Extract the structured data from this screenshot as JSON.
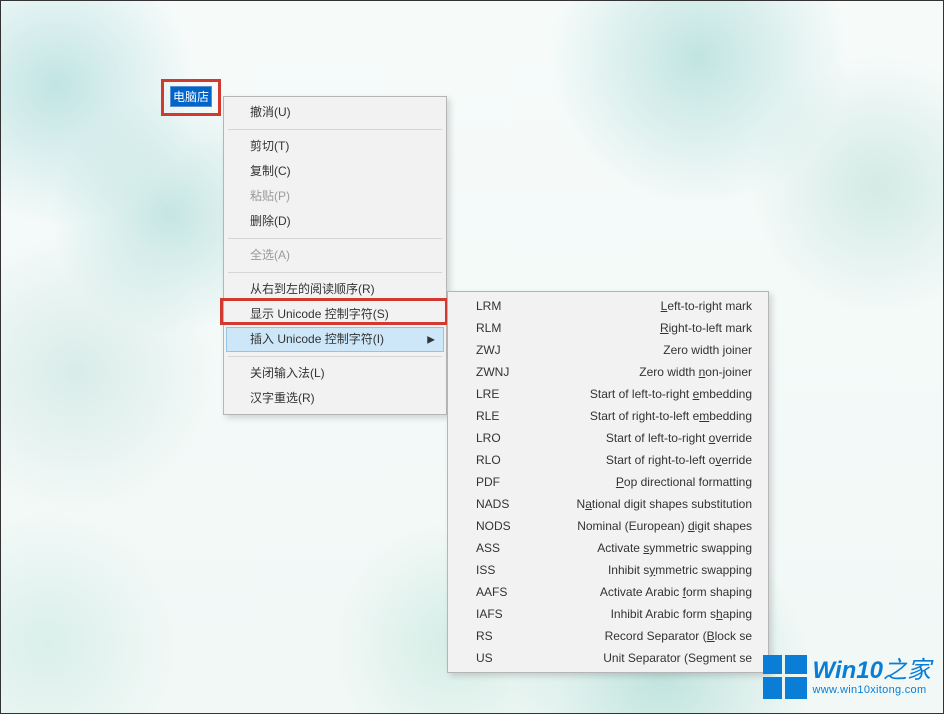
{
  "rename": {
    "selected_text": "电脑店"
  },
  "context_menu": {
    "undo": "撤消(U)",
    "cut": "剪切(T)",
    "copy": "复制(C)",
    "paste": "粘贴(P)",
    "delete": "删除(D)",
    "select_all": "全选(A)",
    "rtl_reading": "从右到左的阅读顺序(R)",
    "show_unicode": "显示 Unicode 控制字符(S)",
    "insert_unicode": "插入 Unicode 控制字符(I)",
    "close_ime": "关闭输入法(L)",
    "hanzi_reselect": "汉字重选(R)"
  },
  "submenu": [
    {
      "code": "LRM",
      "desc_pre": "",
      "hot": "L",
      "desc_post": "eft-to-right mark"
    },
    {
      "code": "RLM",
      "desc_pre": "",
      "hot": "R",
      "desc_post": "ight-to-left mark"
    },
    {
      "code": "ZWJ",
      "desc_pre": "Zero width ",
      "hot": "j",
      "desc_post": "oiner"
    },
    {
      "code": "ZWNJ",
      "desc_pre": "Zero width ",
      "hot": "n",
      "desc_post": "on-joiner"
    },
    {
      "code": "LRE",
      "desc_pre": "Start of left-to-right ",
      "hot": "e",
      "desc_post": "mbedding"
    },
    {
      "code": "RLE",
      "desc_pre": "Start of right-to-left e",
      "hot": "m",
      "desc_post": "bedding"
    },
    {
      "code": "LRO",
      "desc_pre": "Start of left-to-right ",
      "hot": "o",
      "desc_post": "verride"
    },
    {
      "code": "RLO",
      "desc_pre": "Start of right-to-left o",
      "hot": "v",
      "desc_post": "erride"
    },
    {
      "code": "PDF",
      "desc_pre": "",
      "hot": "P",
      "desc_post": "op directional formatting"
    },
    {
      "code": "NADS",
      "desc_pre": "N",
      "hot": "a",
      "desc_post": "tional digit shapes substitution"
    },
    {
      "code": "NODS",
      "desc_pre": "Nominal (European) ",
      "hot": "d",
      "desc_post": "igit shapes"
    },
    {
      "code": "ASS",
      "desc_pre": "Activate ",
      "hot": "s",
      "desc_post": "ymmetric swapping"
    },
    {
      "code": "ISS",
      "desc_pre": "Inhibit s",
      "hot": "y",
      "desc_post": "mmetric swapping"
    },
    {
      "code": "AAFS",
      "desc_pre": "Activate Arabic ",
      "hot": "f",
      "desc_post": "orm shaping"
    },
    {
      "code": "IAFS",
      "desc_pre": "Inhibit Arabic form s",
      "hot": "h",
      "desc_post": "aping"
    },
    {
      "code": "RS",
      "desc_pre": "Record Separator (",
      "hot": "B",
      "desc_post": "lock se"
    },
    {
      "code": "US",
      "desc_pre": "Unit Separator (Se",
      "hot": "g",
      "desc_post": "ment se"
    }
  ],
  "watermark": {
    "brand": "Win10",
    "suffix": "之家",
    "url": "www.win10xitong.com"
  }
}
